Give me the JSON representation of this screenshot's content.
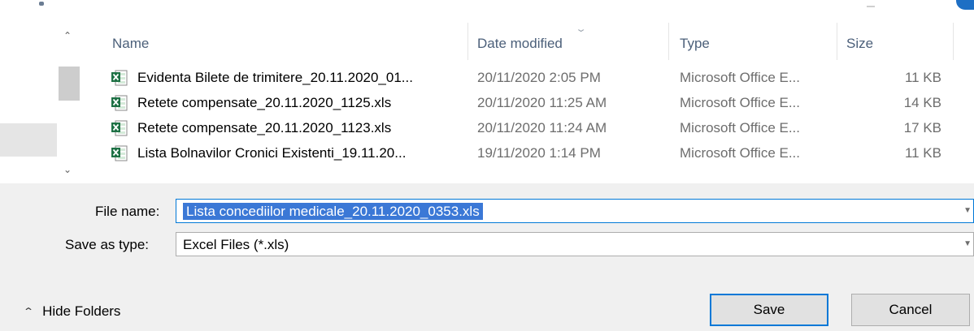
{
  "columns": {
    "name": "Name",
    "date": "Date modified",
    "type": "Type",
    "size": "Size"
  },
  "files": [
    {
      "name": "Evidenta Bilete de trimitere_20.11.2020_01...",
      "date": "20/11/2020 2:05 PM",
      "type": "Microsoft Office E...",
      "size": "11 KB",
      "icon": "excel-file-icon"
    },
    {
      "name": "Retete compensate_20.11.2020_1125.xls",
      "date": "20/11/2020 11:25 AM",
      "type": "Microsoft Office E...",
      "size": "14 KB",
      "icon": "excel-file-icon"
    },
    {
      "name": "Retete compensate_20.11.2020_1123.xls",
      "date": "20/11/2020 11:24 AM",
      "type": "Microsoft Office E...",
      "size": "17 KB",
      "icon": "excel-file-icon"
    },
    {
      "name": "Lista Bolnavilor Cronici Existenti_19.11.20...",
      "date": "19/11/2020 1:14 PM",
      "type": "Microsoft Office E...",
      "size": "11 KB",
      "icon": "excel-file-icon"
    }
  ],
  "form": {
    "file_name_label": "File name:",
    "file_name_value": "Lista concediilor medicale_20.11.2020_0353.xls",
    "save_as_type_label": "Save as type:",
    "save_as_type_value": "Excel Files (*.xls)"
  },
  "footer": {
    "hide_folders": "Hide Folders",
    "save": "Save",
    "cancel": "Cancel"
  },
  "colors": {
    "accent": "#0078d7",
    "selection": "#3b78d6",
    "header_text": "#4c607a",
    "excel_green": "#1e7145"
  }
}
